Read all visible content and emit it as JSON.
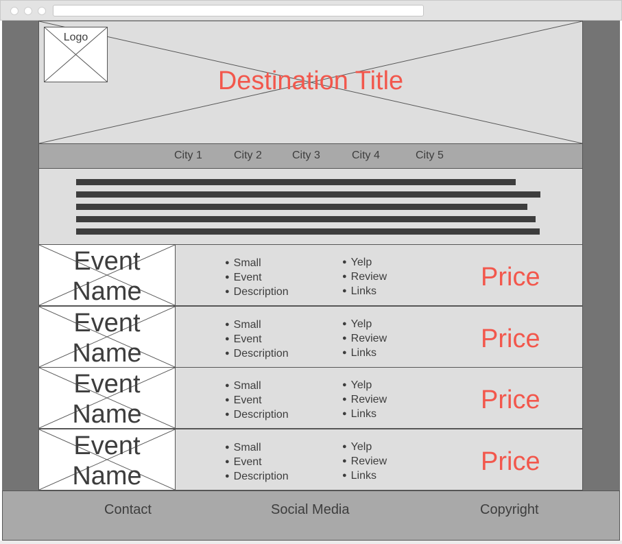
{
  "header": {
    "logo_label": "Logo",
    "title": "Destination Title"
  },
  "nav": {
    "items": [
      "City 1",
      "City 2",
      "City 3",
      "City 4",
      "City 5"
    ]
  },
  "events": [
    {
      "name": "Event Name",
      "description": [
        "Small",
        "Event",
        "Description"
      ],
      "links": [
        "Yelp",
        "Review",
        "Links"
      ],
      "price": "Price"
    },
    {
      "name": "Event Name",
      "description": [
        "Small",
        "Event",
        "Description"
      ],
      "links": [
        "Yelp",
        "Review",
        "Links"
      ],
      "price": "Price"
    },
    {
      "name": "Event Name",
      "description": [
        "Small",
        "Event",
        "Description"
      ],
      "links": [
        "Yelp",
        "Review",
        "Links"
      ],
      "price": "Price"
    },
    {
      "name": "Event Name",
      "description": [
        "Small",
        "Event",
        "Description"
      ],
      "links": [
        "Yelp",
        "Review",
        "Links"
      ],
      "price": "Price"
    }
  ],
  "footer": {
    "contact": "Contact",
    "social": "Social Media",
    "copyright": "Copyright"
  },
  "colors": {
    "accent": "#f2574c",
    "text": "#3d3d3d",
    "panel": "#dedede",
    "nav_bg": "#a9a9a9",
    "outer_bg": "#747474"
  }
}
